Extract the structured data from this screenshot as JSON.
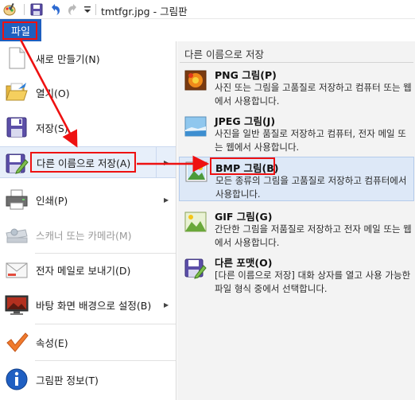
{
  "window": {
    "title": "tmtfgr.jpg - 그림판"
  },
  "quick_access": {
    "app_icon": "paint-app-icon",
    "save_icon": "save-icon",
    "undo_icon": "undo-icon",
    "redo_icon": "redo-icon",
    "customize_icon": "customize-dropdown-icon"
  },
  "file_menu": {
    "button_label": "파일"
  },
  "left_menu": {
    "items": [
      {
        "label": "새로 만들기(N)",
        "icon": "new-document-icon",
        "has_submenu": false,
        "enabled": true
      },
      {
        "label": "열기(O)",
        "icon": "open-folder-icon",
        "has_submenu": false,
        "enabled": true
      },
      {
        "label": "저장(S)",
        "icon": "save-disk-icon",
        "has_submenu": false,
        "enabled": true
      },
      {
        "label": "다른 이름으로 저장(A)",
        "icon": "save-as-icon",
        "has_submenu": true,
        "enabled": true,
        "highlighted": true
      },
      {
        "label": "인쇄(P)",
        "icon": "printer-icon",
        "has_submenu": true,
        "enabled": true
      },
      {
        "label": "스캐너 또는 카메라(M)",
        "icon": "scanner-icon",
        "has_submenu": false,
        "enabled": false
      },
      {
        "label": "전자 메일로 보내기(D)",
        "icon": "email-icon",
        "has_submenu": false,
        "enabled": true
      },
      {
        "label": "바탕 화면 배경으로 설정(B)",
        "icon": "desktop-background-icon",
        "has_submenu": true,
        "enabled": true
      },
      {
        "label": "속성(E)",
        "icon": "checkmark-icon",
        "has_submenu": false,
        "enabled": true
      },
      {
        "label": "그림판 정보(T)",
        "icon": "info-icon",
        "has_submenu": false,
        "enabled": true
      }
    ]
  },
  "save_as_submenu": {
    "title": "다른 이름으로 저장",
    "items": [
      {
        "title": "PNG 그림(P)",
        "description": "사진 또는 그림을 고품질로 저장하고 컴퓨터 또는 웹에서 사용합니다.",
        "icon": "png-image-icon"
      },
      {
        "title": "JPEG 그림(J)",
        "description": "사진을 일반 품질로 저장하고 컴퓨터, 전자 메일 또는 웹에서 사용합니다.",
        "icon": "jpeg-image-icon"
      },
      {
        "title": "BMP 그림(B)",
        "description": "모든 종류의 그림을 고품질로 저장하고 컴퓨터에서 사용합니다.",
        "icon": "bmp-image-icon",
        "highlighted": true
      },
      {
        "title": "GIF 그림(G)",
        "description": "간단한 그림을 저품질로 저장하고 전자 메일 또는 웹에서 사용합니다.",
        "icon": "gif-image-icon"
      },
      {
        "title": "다른 포맷(O)",
        "description": "[다른 이름으로 저장] 대화 상자를 열고 사용 가능한 파일 형식 중에서 선택합니다.",
        "icon": "other-format-icon"
      }
    ]
  },
  "colors": {
    "file_button": "#1e5fbf",
    "annotation_red": "#ee1111",
    "highlight": "#dde8f7"
  }
}
